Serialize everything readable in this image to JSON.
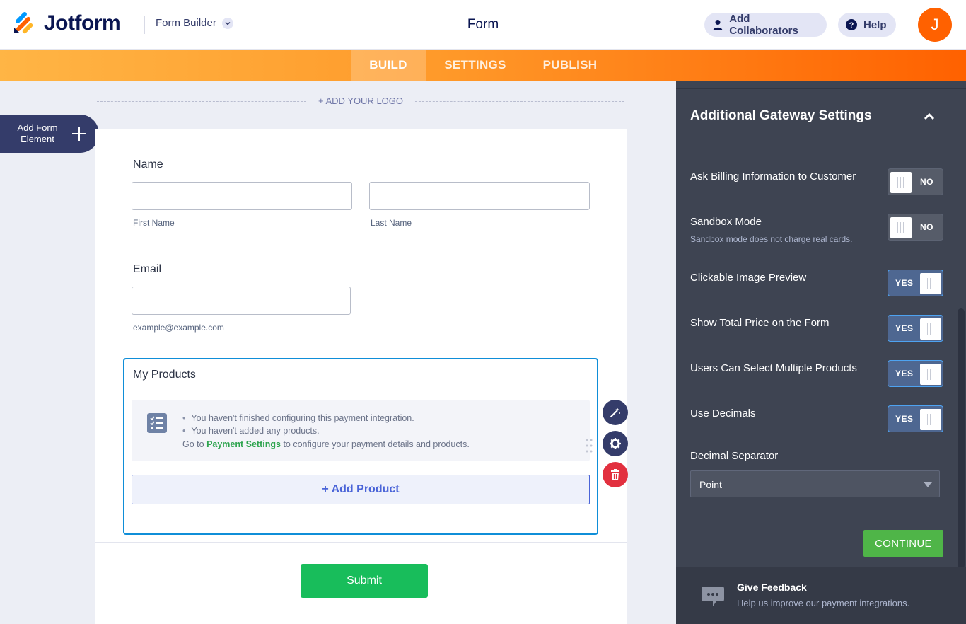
{
  "header": {
    "brand": "Jotform",
    "builder_label": "Form Builder",
    "title": "Form",
    "add_collaborators": "Add Collaborators",
    "help": "Help",
    "avatar_initial": "J"
  },
  "tabs": [
    {
      "label": "BUILD",
      "active": true
    },
    {
      "label": "SETTINGS",
      "active": false
    },
    {
      "label": "PUBLISH",
      "active": false
    }
  ],
  "canvas": {
    "add_logo": "+ ADD YOUR LOGO",
    "add_form_element": "Add Form Element"
  },
  "form": {
    "name_label": "Name",
    "first_name_sublabel": "First Name",
    "last_name_sublabel": "Last Name",
    "email_label": "Email",
    "email_sublabel": "example@example.com",
    "products_title": "My Products",
    "notice_items": [
      "You haven't finished configuring this payment integration.",
      "You haven't added any products."
    ],
    "notice_goto_prefix": "Go to",
    "notice_goto_link": "Payment Settings",
    "notice_goto_suffix": "to configure your payment details and products.",
    "add_product": "+ Add Product",
    "submit": "Submit"
  },
  "panel": {
    "title": "Additional Gateway Settings",
    "options": [
      {
        "label": "Ask Billing Information to Customer",
        "state": "NO",
        "on": false
      },
      {
        "label": "Sandbox Mode",
        "description": "Sandbox mode does not charge real cards.",
        "state": "NO",
        "on": false
      },
      {
        "label": "Clickable Image Preview",
        "state": "YES",
        "on": true
      },
      {
        "label": "Show Total Price on the Form",
        "state": "YES",
        "on": true
      },
      {
        "label": "Users Can Select Multiple Products",
        "state": "YES",
        "on": true
      },
      {
        "label": "Use Decimals",
        "state": "YES",
        "on": true
      }
    ],
    "decimal_separator_label": "Decimal Separator",
    "decimal_separator_value": "Point",
    "continue": "CONTINUE",
    "feedback_title": "Give Feedback",
    "feedback_text": "Help us improve our payment integrations."
  },
  "colors": {
    "brand_orange": "#ff6100",
    "navy": "#0a1551",
    "submit_green": "#18bd5b",
    "continue_green": "#4fb548",
    "panel_bg": "#3e4452",
    "selection_blue": "#0f8ed8"
  }
}
